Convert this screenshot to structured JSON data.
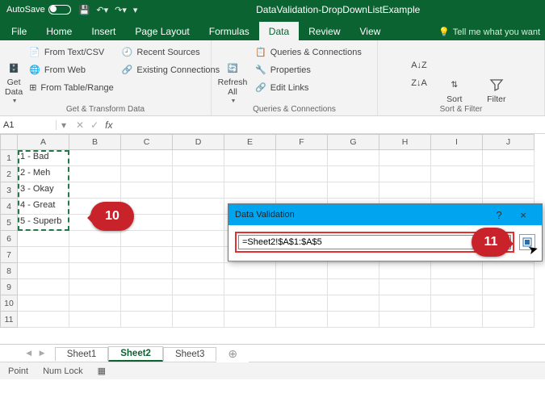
{
  "titlebar": {
    "autosave": "AutoSave",
    "document": "DataValidation-DropDownListExample"
  },
  "tabs": {
    "file": "File",
    "home": "Home",
    "insert": "Insert",
    "page_layout": "Page Layout",
    "formulas": "Formulas",
    "data": "Data",
    "review": "Review",
    "view": "View",
    "tellme": "Tell me what you want"
  },
  "ribbon": {
    "get_data": "Get\nData",
    "from_text": "From Text/CSV",
    "from_web": "From Web",
    "from_table": "From Table/Range",
    "recent": "Recent Sources",
    "existing": "Existing Connections",
    "group1_label": "Get & Transform Data",
    "refresh": "Refresh\nAll",
    "queries": "Queries & Connections",
    "properties": "Properties",
    "editlinks": "Edit Links",
    "group2_label": "Queries & Connections",
    "sort": "Sort",
    "filter": "Filter",
    "group3_label": "Sort & Filter"
  },
  "namebox": "A1",
  "fx_label": "fx",
  "columns": [
    "A",
    "B",
    "C",
    "D",
    "E",
    "F",
    "G",
    "H",
    "I",
    "J"
  ],
  "rows": [
    "1",
    "2",
    "3",
    "4",
    "5",
    "6",
    "7",
    "8",
    "9",
    "10",
    "11"
  ],
  "cells": {
    "a1": "1 - Bad",
    "a2": "2 - Meh",
    "a3": "3 - Okay",
    "a4": "4 - Great",
    "a5": "5 - Superb"
  },
  "dialog": {
    "title": "Data Validation",
    "help": "?",
    "close": "×",
    "formula": "=Sheet2!$A$1:$A$5"
  },
  "annotations": {
    "a10": "10",
    "a11": "11"
  },
  "sheets": {
    "s1": "Sheet1",
    "s2": "Sheet2",
    "s3": "Sheet3"
  },
  "statusbar": {
    "mode": "Point",
    "numlock": "Num Lock"
  }
}
